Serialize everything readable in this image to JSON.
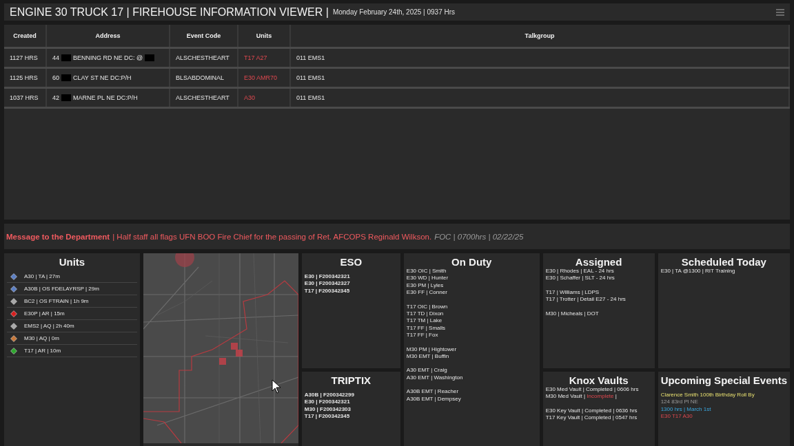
{
  "header": {
    "title": "ENGINE 30 TRUCK 17 | FIREHOUSE INFORMATION VIEWER |",
    "date": "Monday February 24th, 2025 | 0937 Hrs"
  },
  "incidents": {
    "columns": [
      "Created",
      "Address",
      "Event Code",
      "Units",
      "Talkgroup"
    ],
    "rows": [
      {
        "created": "1127 HRS",
        "address": [
          {
            "kind": "text",
            "text": "44"
          },
          {
            "kind": "redacted"
          },
          {
            "kind": "text",
            "text": "BENNING RD NE DC: @"
          },
          {
            "kind": "redacted"
          }
        ],
        "event_code": "ALSCHESTHEART",
        "units": "T17 A27",
        "talkgroup": "011 EMS1"
      },
      {
        "created": "1125 HRS",
        "address": [
          {
            "kind": "text",
            "text": "60"
          },
          {
            "kind": "redacted"
          },
          {
            "kind": "text",
            "text": "CLAY ST NE DC:P/H"
          }
        ],
        "event_code": "BLSABDOMINAL",
        "units": "E30 AMR70",
        "talkgroup": "011 EMS1"
      },
      {
        "created": "1037 HRS",
        "address": [
          {
            "kind": "text",
            "text": "42"
          },
          {
            "kind": "redacted"
          },
          {
            "kind": "text",
            "text": "MARNE PL NE DC:P/H"
          }
        ],
        "event_code": "ALSCHESTHEART",
        "units": "A30",
        "talkgroup": "011 EMS1"
      }
    ]
  },
  "message": {
    "label": "Message to the Department",
    "text": "| Half staff all flags UFN BOO Fire Chief for the passing of Ret. AFCOPS Reginald Wilkson.",
    "footer": "FOC | 0700hrs | 02/22/25"
  },
  "units_panel": {
    "title": "Units",
    "items": [
      {
        "text": "A30 | TA | 27m",
        "color": "#5b7fc4"
      },
      {
        "text": "A30B | OS FDELAYRSP | 29m",
        "color": "#5b7fc4"
      },
      {
        "text": "BC2 | OS FTRAIN | 1h 9m",
        "color": "#a8a8a8"
      },
      {
        "text": "E30P | AR | 15m",
        "color": "#d81e1e"
      },
      {
        "text": "EMS2 | AQ | 2h 40m",
        "color": "#a8a8a8"
      },
      {
        "text": "M30 | AQ | 0m",
        "color": "#c8783a"
      },
      {
        "text": "T17 | AR | 10m",
        "color": "#2ea82e"
      }
    ]
  },
  "eso": {
    "title": "ESO",
    "lines": [
      "E30 | F200342321",
      "E30 | F200342327",
      "T17 | F200342345"
    ]
  },
  "triptix": {
    "title": "TRIPTIX",
    "lines": [
      "A30B | F200342299",
      "E30 | F200342321",
      "M30 | F200342303",
      "T17 | F200342345"
    ]
  },
  "on_duty": {
    "title": "On Duty",
    "groups": [
      [
        "E30 OIC | Smith",
        "E30 WD | Hunter",
        "E30 PM | Lyles",
        "E30 FF | Conner"
      ],
      [
        "T17 OIC | Brown",
        "T17 TD | Dixon",
        "T17 TM | Lake",
        "T17 FF | Smalls",
        "T17 FF | Fox"
      ],
      [
        "M30 PM | Hightower",
        "M30 EMT | Buffin"
      ],
      [
        "A30 EMT | Craig",
        "A30 EMT | Washington"
      ],
      [
        "A30B EMT | Reacher",
        "A30B EMT | Dempsey"
      ]
    ]
  },
  "assigned": {
    "title": "Assigned",
    "groups": [
      [
        "E30 | Rhodes | EAL - 24 hrs",
        "E30 | Schaffer | SLT - 24 hrs"
      ],
      [
        "T17 | Williams | LDPS",
        "T17 | Trotter | Detail E27 - 24 hrs"
      ],
      [
        "M30 | Micheals | DOT"
      ]
    ]
  },
  "scheduled_today": {
    "title": "Scheduled Today",
    "groups": [
      [
        "E30 | TA @1300 | RIT Training"
      ]
    ]
  },
  "knox_vaults": {
    "title": "Knox Vaults",
    "groups": [
      [
        [
          {
            "text": "E30 Med Vault | Completed | 0606 hrs",
            "kind": "plain"
          }
        ],
        [
          {
            "text": "M30 Med Vault |",
            "kind": "plain"
          },
          {
            "text": "Incomplete",
            "kind": "alert"
          },
          {
            "text": "|",
            "kind": "plain"
          }
        ]
      ],
      [
        [
          {
            "text": "E30 Key Vault | Completed | 0636 hrs",
            "kind": "plain"
          }
        ],
        [
          {
            "text": "T17 Key Vault | Completed | 0547 hrs",
            "kind": "plain"
          }
        ]
      ]
    ]
  },
  "special_events": {
    "title": "Upcoming Special Events",
    "lines": [
      {
        "text": "Clarence Smith 100th Birthday Roll By",
        "kind": "name"
      },
      {
        "text": "124 83rd Pl NE",
        "kind": "address"
      },
      {
        "text": "1300 hrs | March 1st",
        "kind": "time"
      },
      {
        "text": "E30 T17 A30",
        "kind": "units"
      }
    ]
  }
}
